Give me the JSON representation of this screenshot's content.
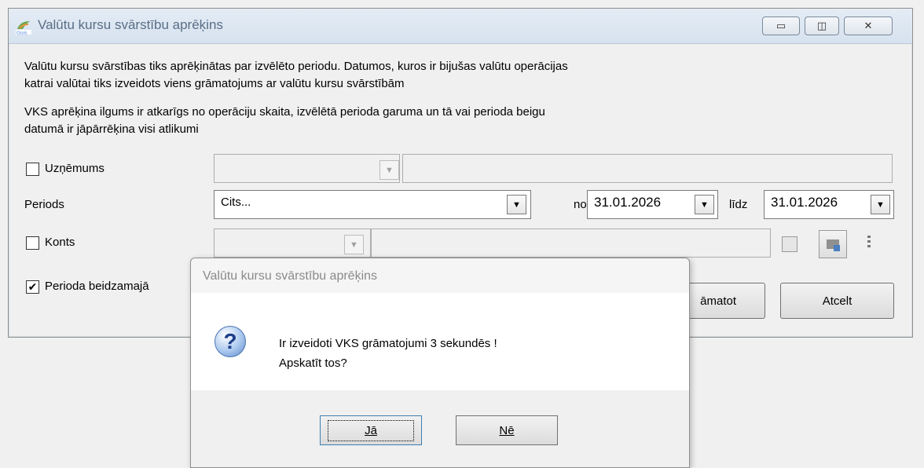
{
  "window": {
    "title": "Valūtu kursu svārstību aprēķins",
    "minimize": "▭",
    "maximize": "◫",
    "close": "✕",
    "desc1_line1": "Valūtu kursu svārstības tiks aprēķinātas par izvēlēto periodu. Datumos, kuros ir bijušas valūtu operācijas",
    "desc1_line2": "katrai valūtai tiks izveidots viens grāmatojums ar valūtu kursu svārstībām",
    "desc2_line1": "VKS aprēķina ilgums ir atkarīgs no operāciju skaita, izvēlētā perioda garuma un tā vai perioda beigu",
    "desc2_line2": "datumā ir jāpārrēķina visi atlikumi"
  },
  "form": {
    "company_label": "Uzņēmums",
    "company_checked": false,
    "period_label": "Periods",
    "period_value": "Cits...",
    "from_label": "no",
    "from_value": "31.01.2026",
    "to_label": "līdz",
    "to_value": "31.01.2026",
    "account_label": "Konts",
    "account_checked": false,
    "closing_label": "Perioda beidzamajā",
    "closing_checked": true,
    "post_button": "āmatot",
    "cancel_button": "Atcelt"
  },
  "dialog": {
    "title": "Valūtu kursu svārstību aprēķins",
    "message_line1": "Ir izveidoti VKS grāmatojumi 3 sekundēs !",
    "message_line2": "Apskatīt tos?",
    "yes": "Jā",
    "no": "Nē"
  },
  "colors": {
    "titlebar": "#dbe6f1",
    "title_text": "#5a6e86"
  }
}
